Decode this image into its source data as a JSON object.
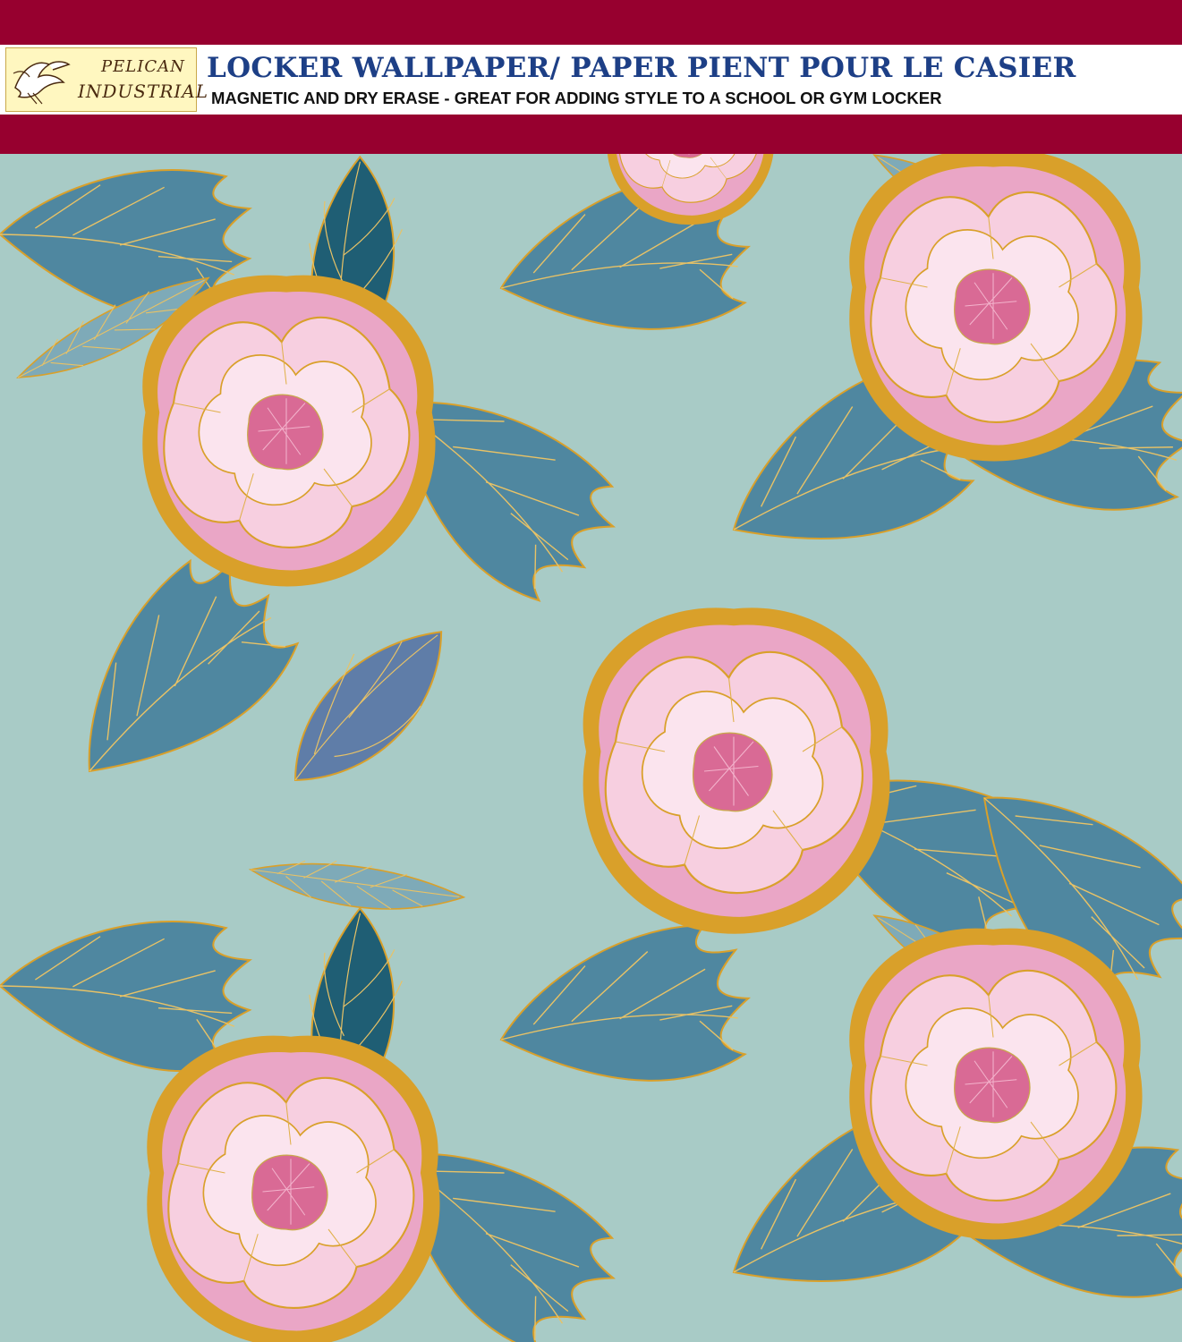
{
  "brand": {
    "line1": "PELICAN",
    "line2": "INDUSTRIAL",
    "logo_icon": "pelican-icon"
  },
  "product": {
    "headline": "LOCKER WALLPAPER/ PAPER PIENT POUR LE CASIER",
    "subline": "MAGNETIC AND DRY ERASE - GREAT FOR ADDING STYLE TO A SCHOOL OR GYM LOCKER"
  },
  "colors": {
    "banner": "#97002f",
    "pattern_background": "#a8cbc6",
    "leaf_dark": "#1f5e74",
    "leaf_mid": "#4f87a0",
    "leaf_slate": "#5f7da8",
    "leaf_light": "#7eaab8",
    "gold": "#d9a02a",
    "petal": "#f7cfe0",
    "petal_deep": "#eaa6c6",
    "flower_center": "#d96a95"
  }
}
